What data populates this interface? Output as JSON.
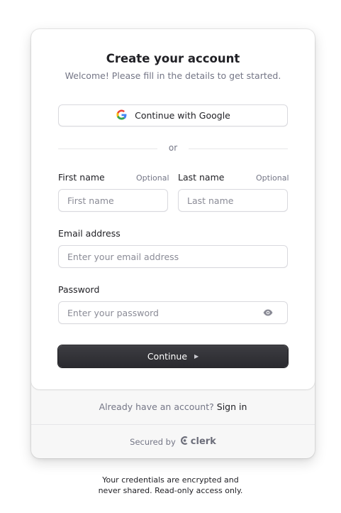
{
  "header": {
    "title": "Create your account",
    "subtitle": "Welcome! Please fill in the details to get started."
  },
  "social": {
    "google_label": "Continue with Google"
  },
  "divider": {
    "text": "or"
  },
  "form": {
    "first_name": {
      "label": "First name",
      "optional": "Optional",
      "placeholder": "First name",
      "value": ""
    },
    "last_name": {
      "label": "Last name",
      "optional": "Optional",
      "placeholder": "Last name",
      "value": ""
    },
    "email": {
      "label": "Email address",
      "placeholder": "Enter your email address",
      "value": ""
    },
    "password": {
      "label": "Password",
      "placeholder": "Enter your password",
      "value": ""
    },
    "submit_label": "Continue"
  },
  "footer": {
    "prompt": "Already have an account?",
    "sign_in_label": "Sign in",
    "secured_by": "Secured by",
    "brand": "clerk"
  },
  "note": {
    "line1": "Your credentials are encrypted and",
    "line2": "never shared. Read-only access only."
  },
  "colors": {
    "primary_button": "#2f2f34",
    "text": "#212126",
    "muted": "#747686",
    "border": "#d9d9de"
  },
  "icons": {
    "google": "google-g-icon",
    "eye": "eye-icon",
    "arrow": "play-arrow-icon",
    "clerk": "clerk-logo-icon"
  }
}
